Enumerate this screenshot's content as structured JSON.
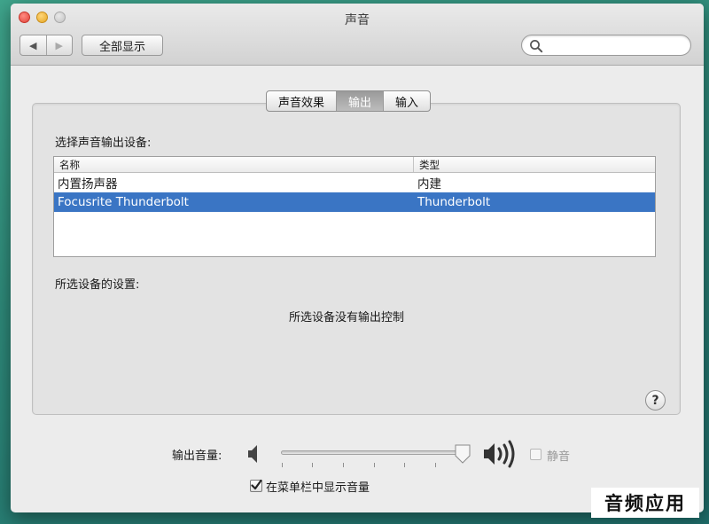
{
  "window": {
    "title": "声音"
  },
  "toolbar": {
    "back_glyph": "◀",
    "forward_glyph": "▶",
    "show_all_label": "全部显示",
    "search": {
      "value": "",
      "placeholder": ""
    }
  },
  "tabs": [
    {
      "label": "声音效果",
      "active": false
    },
    {
      "label": "输出",
      "active": true
    },
    {
      "label": "输入",
      "active": false
    }
  ],
  "output": {
    "select_device_label": "选择声音输出设备:",
    "table": {
      "columns": [
        "名称",
        "类型"
      ],
      "rows": [
        {
          "name": "内置扬声器",
          "type": "内建",
          "selected": false
        },
        {
          "name": "Focusrite Thunderbolt",
          "type": "Thunderbolt",
          "selected": true
        }
      ]
    },
    "device_settings_label": "所选设备的设置:",
    "no_controls_message": "所选设备没有输出控制",
    "help_label": "?"
  },
  "volume": {
    "label": "输出音量:",
    "level": 0.97,
    "mute_label": "静音",
    "muted": false,
    "show_in_menubar_label": "在菜单栏中显示音量",
    "show_in_menubar": true
  },
  "watermark": {
    "text": "音频应用"
  },
  "icons": {
    "search": "magnifier-icon",
    "speaker_low": "speaker-low-icon",
    "speaker_high": "speaker-high-icon"
  },
  "colors": {
    "selection": "#3a75c4"
  }
}
